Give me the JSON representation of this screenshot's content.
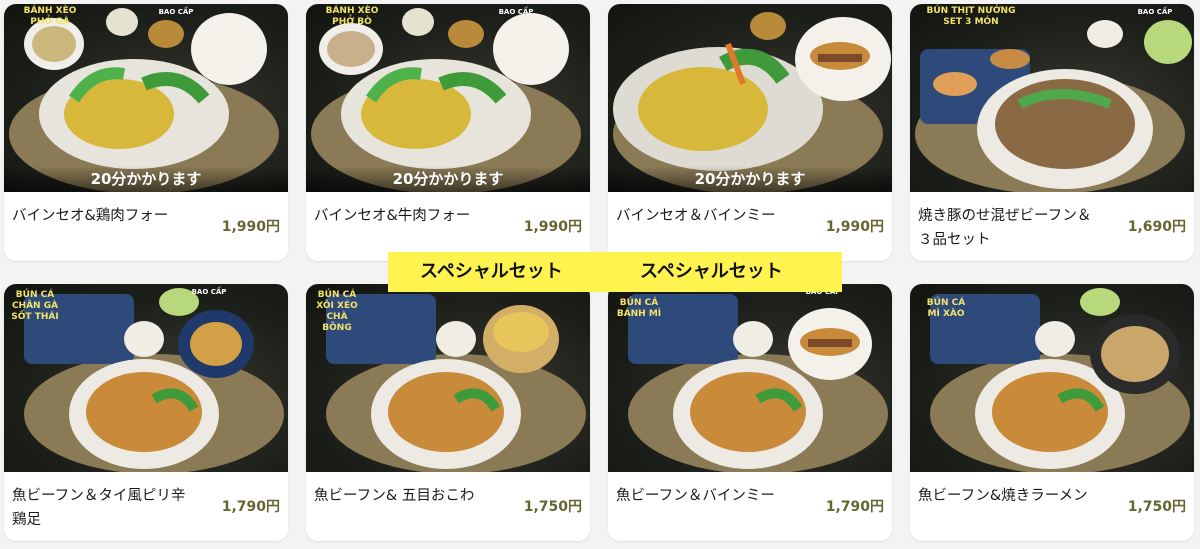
{
  "menu": {
    "row1": [
      {
        "name": "バインセオ&鶏肉フォー",
        "price": "1,990円",
        "wait": "20分かかります",
        "tag": "BÁNH XÈO\nPHỞ GÀ"
      },
      {
        "name": "バインセオ&牛肉フォー",
        "price": "1,990円",
        "wait": "20分かかります",
        "tag": "BÁNH XÈO\nPHỞ BÒ"
      },
      {
        "name": "バインセオ＆バインミー",
        "price": "1,990円",
        "wait": "20分かかります",
        "tag": ""
      },
      {
        "name": "焼き豚のせ混ぜビーフン＆３品セット",
        "price": "1,690円",
        "wait": "",
        "tag": "BÚN THỊT NƯỚNG\nSET 3 MÓN"
      }
    ],
    "row2": [
      {
        "name": "魚ビーフン＆タイ風ピリ辛鶏足",
        "price": "1,790円",
        "tag": "BÚN CÁ\nCHÂN GÀ\nSỐT THÁI"
      },
      {
        "name": "魚ビーフン& 五目おこわ",
        "price": "1,750円",
        "tag": "BÚN CÁ\nXÔI XÉO\nCHÀ BÔNG"
      },
      {
        "name": "魚ビーフン＆バインミー",
        "price": "1,790円",
        "tag": "BÚN CÁ\nBÁNH MÌ"
      },
      {
        "name": "魚ビーフン&焼きラーメン",
        "price": "1,750円",
        "tag": "BÚN CÁ\nMÌ XÀO"
      }
    ]
  },
  "logo_text": "BAO CẤP",
  "banner": {
    "left": "スペシャルセット",
    "right": "スペシャルセット"
  },
  "colors": {
    "price": "#666633",
    "banner": "#fff44f",
    "tag": "#f4e36b"
  }
}
